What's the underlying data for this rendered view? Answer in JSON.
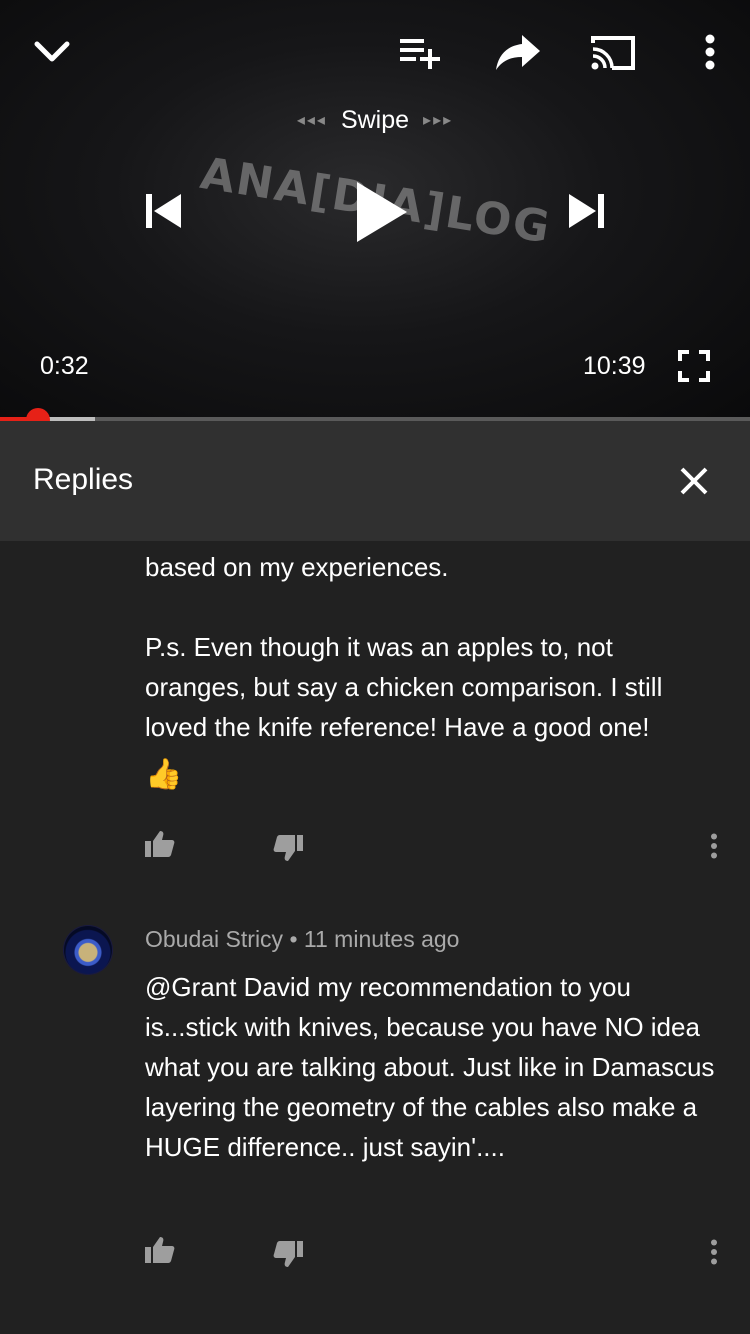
{
  "player": {
    "swipe_label": "Swipe",
    "swipe_left_arrows": "◂◂◂",
    "swipe_right_arrows": "▸▸▸",
    "watermark": "ANA[DIA]LOG",
    "current_time": "0:32",
    "duration": "10:39",
    "progress_fraction": 0.05,
    "buffered_fraction": 0.127,
    "accent_color": "#e62117"
  },
  "replies": {
    "title": "Replies"
  },
  "comments": [
    {
      "text": "based on my experiences.\n\nP.s. Even though it was an apples to, not oranges, but say a chicken comparison. I still loved the knife reference! Have a good one!",
      "emoji": "👍"
    },
    {
      "author": "Obudai Stricy",
      "separator": "•",
      "time": "11 minutes ago",
      "text": "@Grant David my recommendation to you is...stick with knives, because you have NO idea what you are talking about. Just like in Damascus layering the geometry of the cables also make a HUGE difference.. just sayin'...."
    }
  ],
  "icons": {
    "collapse": "chevron-down-icon",
    "add_to_playlist": "playlist-add-icon",
    "share": "share-icon",
    "cast": "cast-icon",
    "more": "more-vert-icon",
    "previous": "skip-previous-icon",
    "play": "play-icon",
    "next": "skip-next-icon",
    "fullscreen": "fullscreen-icon",
    "close": "close-icon",
    "like": "thumb-up-icon",
    "dislike": "thumb-down-icon"
  }
}
